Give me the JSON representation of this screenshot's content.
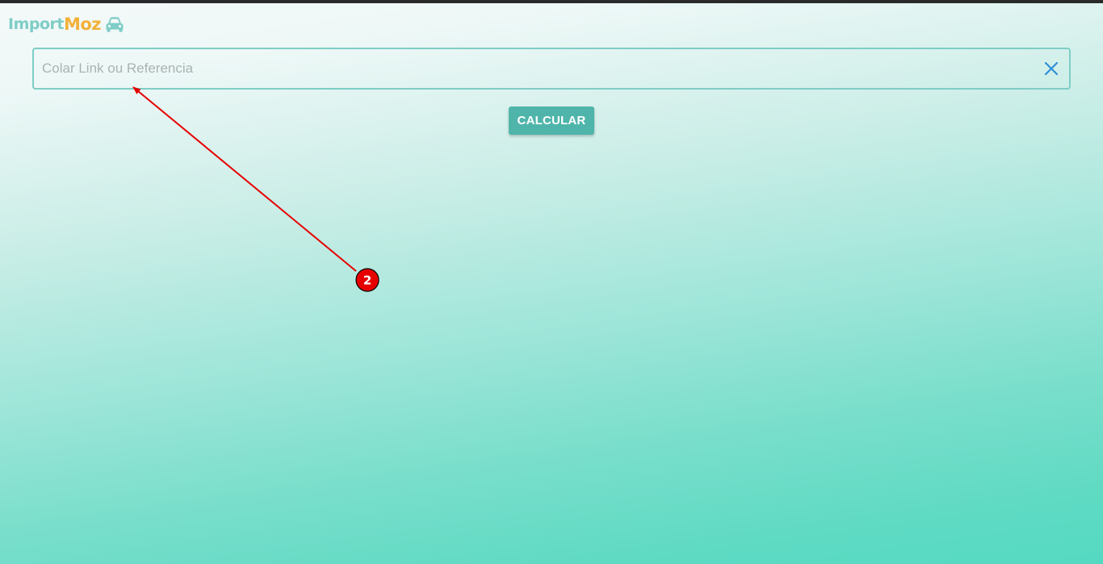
{
  "brand": {
    "part1": "Import",
    "part2": "Moz",
    "icon": "car-icon",
    "colors": {
      "import": "#7fcdc6",
      "moz": "#f3b13a"
    }
  },
  "search": {
    "placeholder": "Colar Link ou Referencia",
    "value": "",
    "clear_icon": "close-icon"
  },
  "actions": {
    "calculate_label": "CALCULAR"
  },
  "annotation": {
    "badge_label": "2",
    "color": "#e60000"
  }
}
